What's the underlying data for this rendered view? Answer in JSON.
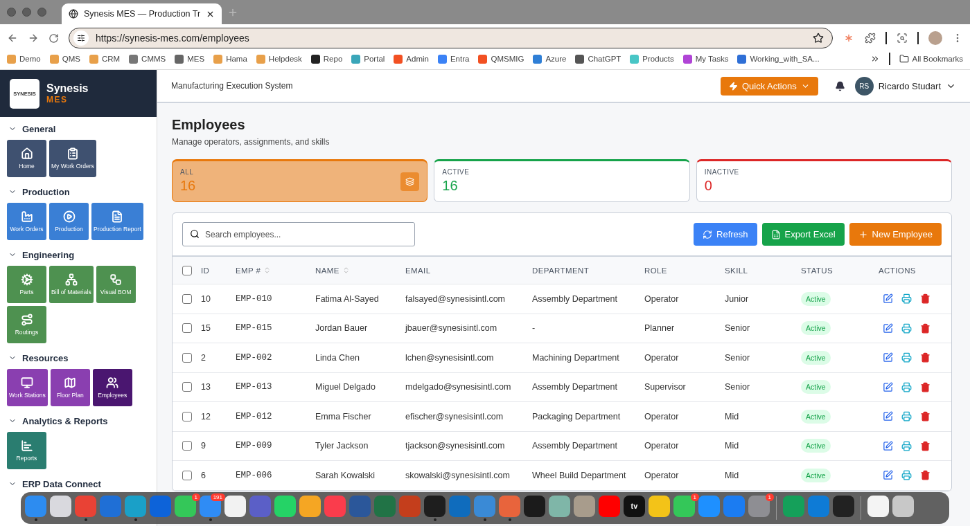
{
  "browser": {
    "tab_title": "Synesis MES — Production Tr",
    "url": "https://synesis-mes.com/employees",
    "bookmarks": [
      {
        "label": "Demo",
        "color": "#e8a04a"
      },
      {
        "label": "QMS",
        "color": "#e8a04a"
      },
      {
        "label": "CRM",
        "color": "#e8a04a"
      },
      {
        "label": "CMMS",
        "color": "#777777"
      },
      {
        "label": "MES",
        "color": "#666666"
      },
      {
        "label": "Hama",
        "color": "#e8a04a"
      },
      {
        "label": "Helpdesk",
        "color": "#e8a04a"
      },
      {
        "label": "Repo",
        "color": "#222222"
      },
      {
        "label": "Portal",
        "color": "#3aa6b9"
      },
      {
        "label": "Admin",
        "color": "#f25022"
      },
      {
        "label": "Entra",
        "color": "#3b82f6"
      },
      {
        "label": "QMSMIG",
        "color": "#f25022"
      },
      {
        "label": "Azure",
        "color": "#2f7fd6"
      },
      {
        "label": "ChatGPT",
        "color": "#555555"
      },
      {
        "label": "Products",
        "color": "#49c6c6"
      },
      {
        "label": "My Tasks",
        "color": "#b044d6"
      },
      {
        "label": "Working_with_SA...",
        "color": "#2f6fd6"
      }
    ],
    "all_bookmarks": "All Bookmarks"
  },
  "brand": {
    "name": "Synesis",
    "sub": "MES",
    "logo_text": "SYNESIS"
  },
  "header": {
    "title": "Manufacturing Execution System",
    "quick_actions": "Quick Actions",
    "user_initials": "RS",
    "user_name": "Ricardo Studart"
  },
  "sidebar": [
    {
      "title": "General",
      "expanded": true,
      "color": "#3f5170",
      "items": [
        {
          "label": "Home",
          "selected": false
        },
        {
          "label": "My Work Orders",
          "selected": false
        }
      ]
    },
    {
      "title": "Production",
      "expanded": true,
      "color": "#3a7fd5",
      "items": [
        {
          "label": "Work Orders",
          "selected": false
        },
        {
          "label": "Production",
          "selected": false
        },
        {
          "label": "Production Report",
          "selected": false
        }
      ]
    },
    {
      "title": "Engineering",
      "expanded": true,
      "color": "#4e9150",
      "items": [
        {
          "label": "Parts",
          "selected": false
        },
        {
          "label": "Bill of Materials",
          "selected": false
        },
        {
          "label": "Visual BOM",
          "selected": false
        },
        {
          "label": "Routings",
          "selected": false
        }
      ]
    },
    {
      "title": "Resources",
      "expanded": true,
      "color": "#8a3fb0",
      "items": [
        {
          "label": "Work Stations",
          "selected": false
        },
        {
          "label": "Floor Plan",
          "selected": false
        },
        {
          "label": "Employees",
          "selected": true
        }
      ]
    },
    {
      "title": "Analytics & Reports",
      "expanded": true,
      "color": "#2a7d70",
      "items": [
        {
          "label": "Reports",
          "selected": false
        }
      ]
    },
    {
      "title": "ERP Data Connect",
      "expanded": true
    }
  ],
  "page": {
    "title": "Employees",
    "subtitle": "Manage operators, assignments, and skills"
  },
  "stats": [
    {
      "label": "ALL",
      "value": "16",
      "color": "#e8780c",
      "selected": true
    },
    {
      "label": "ACTIVE",
      "value": "16",
      "color": "#16a34a",
      "selected": false
    },
    {
      "label": "INACTIVE",
      "value": "0",
      "color": "#dc2626",
      "selected": false
    }
  ],
  "search": {
    "placeholder": "Search employees..."
  },
  "buttons": [
    {
      "label": "Refresh",
      "kind": "refresh"
    },
    {
      "label": "Export Excel",
      "kind": "export"
    },
    {
      "label": "New Employee",
      "kind": "new"
    }
  ],
  "table": {
    "columns": [
      {
        "label": "ID",
        "sortable": false
      },
      {
        "label": "EMP #",
        "sortable": true
      },
      {
        "label": "NAME",
        "sortable": true
      },
      {
        "label": "EMAIL",
        "sortable": false
      },
      {
        "label": "DEPARTMENT",
        "sortable": false
      },
      {
        "label": "ROLE",
        "sortable": false
      },
      {
        "label": "SKILL",
        "sortable": false
      },
      {
        "label": "STATUS",
        "sortable": false
      },
      {
        "label": "ACTIONS",
        "sortable": false
      }
    ],
    "all_checked": false,
    "rows": [
      {
        "checked": false,
        "id": "10",
        "emp": "EMP-010",
        "name": "Fatima Al-Sayed",
        "email": "falsayed@synesisintl.com",
        "department": "Assembly Department",
        "role": "Operator",
        "skill": "Junior",
        "status": "Active"
      },
      {
        "checked": false,
        "id": "15",
        "emp": "EMP-015",
        "name": "Jordan Bauer",
        "email": "jbauer@synesisintl.com",
        "department": "-",
        "role": "Planner",
        "skill": "Senior",
        "status": "Active"
      },
      {
        "checked": false,
        "id": "2",
        "emp": "EMP-002",
        "name": "Linda Chen",
        "email": "lchen@synesisintl.com",
        "department": "Machining Department",
        "role": "Operator",
        "skill": "Senior",
        "status": "Active"
      },
      {
        "checked": false,
        "id": "13",
        "emp": "EMP-013",
        "name": "Miguel Delgado",
        "email": "mdelgado@synesisintl.com",
        "department": "Assembly Department",
        "role": "Supervisor",
        "skill": "Senior",
        "status": "Active"
      },
      {
        "checked": false,
        "id": "12",
        "emp": "EMP-012",
        "name": "Emma Fischer",
        "email": "efischer@synesisintl.com",
        "department": "Packaging Department",
        "role": "Operator",
        "skill": "Mid",
        "status": "Active"
      },
      {
        "checked": false,
        "id": "9",
        "emp": "EMP-009",
        "name": "Tyler Jackson",
        "email": "tjackson@synesisintl.com",
        "department": "Assembly Department",
        "role": "Operator",
        "skill": "Mid",
        "status": "Active"
      },
      {
        "checked": false,
        "id": "6",
        "emp": "EMP-006",
        "name": "Sarah Kowalski",
        "email": "skowalski@synesisintl.com",
        "department": "Wheel Build Department",
        "role": "Operator",
        "skill": "Mid",
        "status": "Active"
      }
    ]
  },
  "dock": [
    {
      "color": "#2d8cf0",
      "running": true
    },
    {
      "color": "#d9d9de",
      "running": false
    },
    {
      "color": "#e94235",
      "running": true
    },
    {
      "color": "#1f6fd6",
      "running": false
    },
    {
      "color": "#1aa0c8",
      "running": true
    },
    {
      "color": "#0d63d9",
      "running": false
    },
    {
      "color": "#34c759",
      "running": false,
      "badge": "1"
    },
    {
      "color": "#2f8cf5",
      "running": true,
      "badge": "191"
    },
    {
      "color": "#f2f2f2",
      "running": false
    },
    {
      "color": "#5b5fc7",
      "running": false
    },
    {
      "color": "#25d366",
      "running": false
    },
    {
      "color": "#f5a623",
      "running": false
    },
    {
      "color": "#fa3c4c",
      "running": false
    },
    {
      "color": "#2b579a",
      "running": false
    },
    {
      "color": "#217346",
      "running": false
    },
    {
      "color": "#c43e1c",
      "running": false
    },
    {
      "color": "#1e1e1e",
      "running": true
    },
    {
      "color": "#0f6cbd",
      "running": false
    },
    {
      "color": "#3a8ad6",
      "running": true
    },
    {
      "color": "#e8643c",
      "running": true
    },
    {
      "color": "#1b1b1b",
      "running": false
    },
    {
      "color": "#7fb6a8",
      "running": false
    },
    {
      "color": "#a89c8c",
      "running": false
    },
    {
      "color": "#ff0000",
      "running": false
    },
    {
      "color": "#111111",
      "running": false,
      "glyph": "tv"
    },
    {
      "color": "#f3c318",
      "running": false
    },
    {
      "color": "#34c759",
      "running": false,
      "badge": "1"
    },
    {
      "color": "#1e90ff",
      "running": false
    },
    {
      "color": "#1b7cf2",
      "running": false
    },
    {
      "color": "#8e8e93",
      "running": false,
      "badge": "1"
    },
    {
      "color": "#15a05a",
      "running": false
    },
    {
      "color": "#0e7bd6",
      "running": false
    },
    {
      "color": "#222222",
      "running": false
    },
    {
      "color": "#f4f4f4",
      "running": false
    },
    {
      "color": "#c8c8c8",
      "running": false
    }
  ]
}
